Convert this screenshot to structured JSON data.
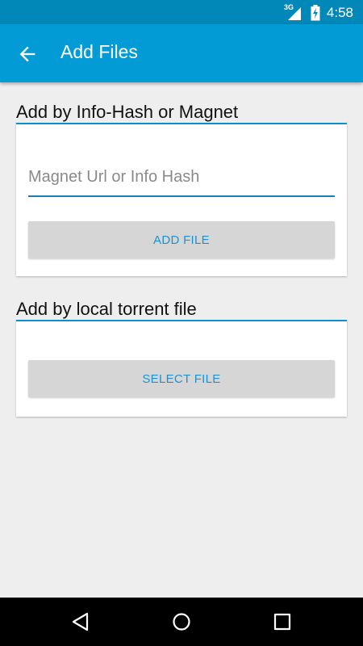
{
  "status_bar": {
    "network": "3G",
    "time": "4:58"
  },
  "app_bar": {
    "title": "Add Files",
    "back_icon": "arrow-back-icon"
  },
  "section_magnet": {
    "heading": "Add by Info-Hash or Magnet",
    "input_placeholder": "Magnet Url or Info Hash",
    "input_value": "",
    "button_label": "ADD FILE"
  },
  "section_local": {
    "heading": "Add by local torrent file",
    "button_label": "SELECT FILE"
  },
  "nav_bar": {
    "icons": [
      "back-triangle-icon",
      "home-circle-icon",
      "recents-square-icon"
    ]
  },
  "colors": {
    "status_bar": "#0288b8",
    "app_bar": "#039bd6",
    "accent": "#1e92cf",
    "background": "#eeeeee",
    "button_bg": "#d6d6d6"
  }
}
